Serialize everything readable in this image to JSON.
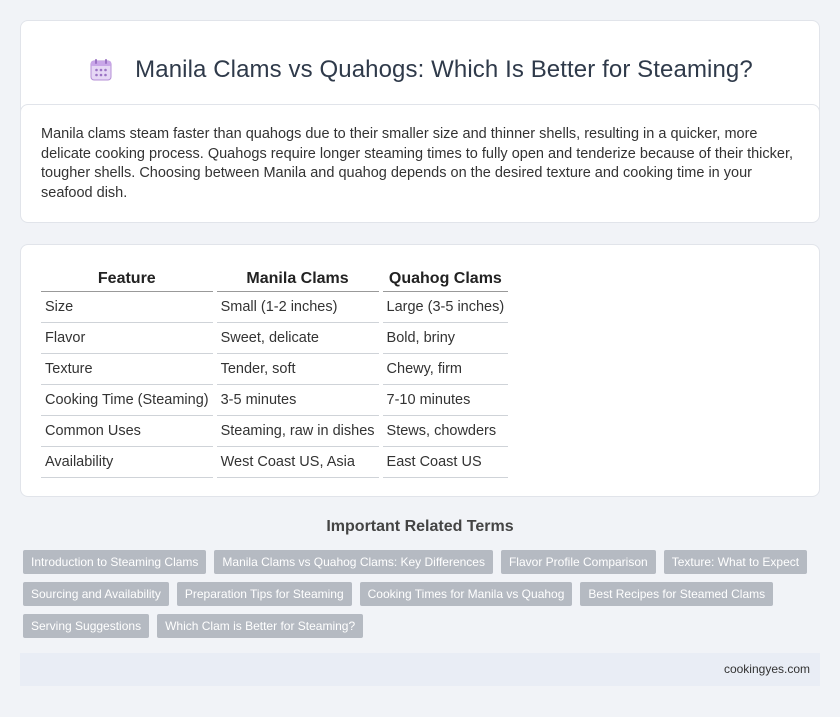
{
  "header": {
    "icon": "calendar-icon",
    "title": "Manila Clams vs Quahogs: Which Is Better for Steaming?"
  },
  "summary": {
    "text": "Manila clams steam faster than quahogs due to their smaller size and thinner shells, resulting in a quicker, more delicate cooking process. Quahogs require longer steaming times to fully open and tenderize because of their thicker, tougher shells. Choosing between Manila and quahog depends on the desired texture and cooking time in your seafood dish."
  },
  "table": {
    "headers": [
      "Feature",
      "Manila Clams",
      "Quahog Clams"
    ],
    "rows": [
      [
        "Size",
        "Small (1-2 inches)",
        "Large (3-5 inches)"
      ],
      [
        "Flavor",
        "Sweet, delicate",
        "Bold, briny"
      ],
      [
        "Texture",
        "Tender, soft",
        "Chewy, firm"
      ],
      [
        "Cooking Time (Steaming)",
        "3-5 minutes",
        "7-10 minutes"
      ],
      [
        "Common Uses",
        "Steaming, raw in dishes",
        "Stews, chowders"
      ],
      [
        "Availability",
        "West Coast US, Asia",
        "East Coast US"
      ]
    ]
  },
  "related": {
    "heading": "Important Related Terms",
    "tags": [
      "Introduction to Steaming Clams",
      "Manila Clams vs Quahog Clams: Key Differences",
      "Flavor Profile Comparison",
      "Texture: What to Expect",
      "Sourcing and Availability",
      "Preparation Tips for Steaming",
      "Cooking Times for Manila vs Quahog",
      "Best Recipes for Steamed Clams",
      "Serving Suggestions",
      "Which Clam is Better for Steaming?"
    ]
  },
  "footer": {
    "site": "cookingyes.com"
  },
  "colors": {
    "background": "#f1f3f7",
    "card": "#ffffff",
    "tag": "#b5bac2",
    "footer": "#e9edf5",
    "icon_accent": "#c9a6e8"
  }
}
